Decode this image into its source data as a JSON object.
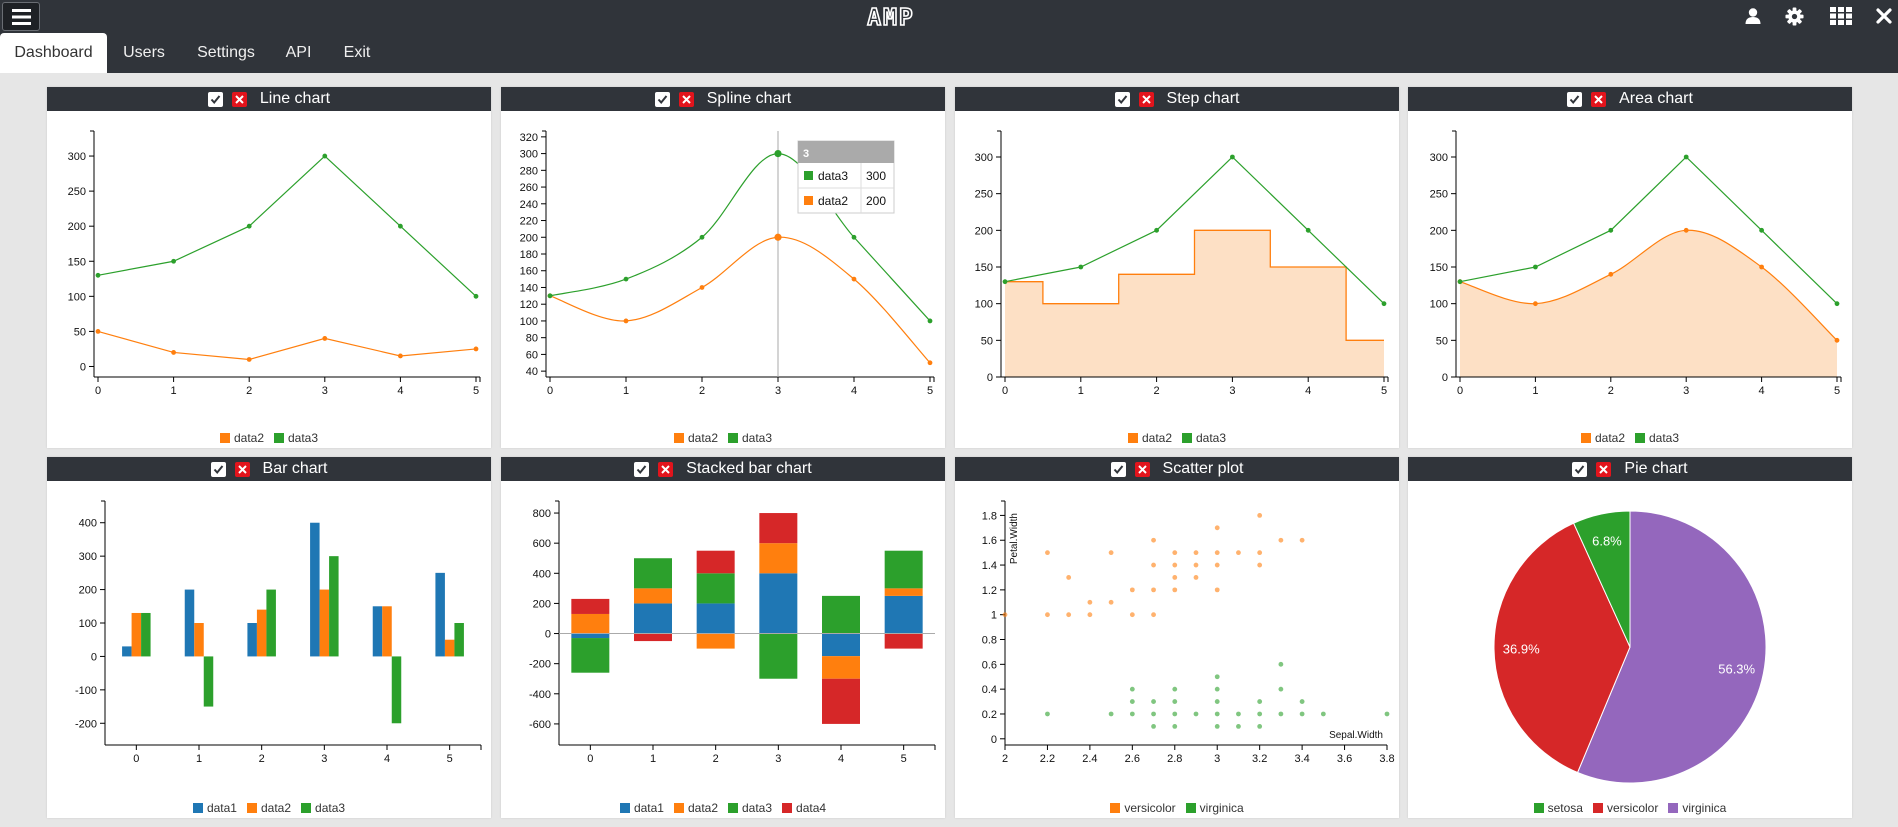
{
  "app": {
    "logo_text": "AMP"
  },
  "nav": {
    "tabs": [
      "Dashboard",
      "Users",
      "Settings",
      "API",
      "Exit"
    ],
    "active": 0
  },
  "icons": [
    "hamburger-menu-icon",
    "user-icon",
    "gear-icon",
    "grid-icon",
    "close-icon"
  ],
  "colors": {
    "data1": "#1f77b4",
    "data2": "#ff7f0e",
    "data3": "#2ca02c",
    "data4": "#d62728",
    "virginica_pie": "#9467bd",
    "header": "#30343a",
    "close_button": "#e2141c"
  },
  "panels": {
    "line": {
      "title": "Line chart"
    },
    "spline": {
      "title": "Spline chart"
    },
    "step": {
      "title": "Step chart"
    },
    "area": {
      "title": "Area chart"
    },
    "bar": {
      "title": "Bar chart"
    },
    "stacked": {
      "title": "Stacked bar chart"
    },
    "scatter": {
      "title": "Scatter plot"
    },
    "pie": {
      "title": "Pie chart"
    }
  },
  "chart_data": [
    {
      "id": "line",
      "type": "line",
      "title": "Line chart",
      "x": [
        0,
        1,
        2,
        3,
        4,
        5
      ],
      "series": [
        {
          "name": "data2",
          "values": [
            50,
            20,
            10,
            40,
            15,
            25
          ]
        },
        {
          "name": "data3",
          "values": [
            130,
            150,
            200,
            300,
            200,
            100
          ]
        }
      ],
      "ylim": [
        -15,
        330
      ],
      "yticks": [
        0,
        50,
        100,
        150,
        200,
        250,
        300
      ],
      "xticks": [
        0,
        1,
        2,
        3,
        4,
        5
      ]
    },
    {
      "id": "spline",
      "type": "line",
      "smooth": true,
      "title": "Spline chart",
      "x": [
        0,
        1,
        2,
        3,
        4,
        5
      ],
      "series": [
        {
          "name": "data2",
          "values": [
            130,
            100,
            140,
            200,
            150,
            50
          ]
        },
        {
          "name": "data3",
          "values": [
            130,
            150,
            200,
            300,
            200,
            100
          ]
        }
      ],
      "ylim": [
        33,
        327
      ],
      "yticks": [
        40,
        60,
        80,
        100,
        120,
        140,
        160,
        180,
        200,
        220,
        240,
        260,
        280,
        300,
        320
      ],
      "xticks": [
        0,
        1,
        2,
        3,
        4,
        5
      ],
      "tooltip": {
        "x": "3",
        "rows": [
          {
            "name": "data3",
            "value": 300
          },
          {
            "name": "data2",
            "value": 200
          }
        ]
      }
    },
    {
      "id": "step",
      "type": "area",
      "step": true,
      "title": "Step chart",
      "x": [
        0,
        1,
        2,
        3,
        4,
        5
      ],
      "series": [
        {
          "name": "data2",
          "values": [
            130,
            100,
            140,
            200,
            150,
            50
          ]
        },
        {
          "name": "data3",
          "values": [
            130,
            150,
            200,
            300,
            200,
            100
          ]
        }
      ],
      "ylim": [
        0,
        330
      ],
      "yticks": [
        0,
        50,
        100,
        150,
        200,
        250,
        300
      ],
      "xticks": [
        0,
        1,
        2,
        3,
        4,
        5
      ]
    },
    {
      "id": "area",
      "type": "area",
      "smooth": true,
      "title": "Area chart",
      "x": [
        0,
        1,
        2,
        3,
        4,
        5
      ],
      "series": [
        {
          "name": "data2",
          "values": [
            130,
            100,
            140,
            200,
            150,
            50
          ]
        },
        {
          "name": "data3",
          "values": [
            130,
            150,
            200,
            300,
            200,
            100
          ]
        }
      ],
      "ylim": [
        0,
        330
      ],
      "yticks": [
        0,
        50,
        100,
        150,
        200,
        250,
        300
      ],
      "xticks": [
        0,
        1,
        2,
        3,
        4,
        5
      ]
    },
    {
      "id": "bar",
      "type": "bar",
      "title": "Bar chart",
      "categories": [
        "0",
        "1",
        "2",
        "3",
        "4",
        "5"
      ],
      "series": [
        {
          "name": "data1",
          "values": [
            30,
            200,
            100,
            400,
            150,
            250
          ]
        },
        {
          "name": "data2",
          "values": [
            130,
            100,
            140,
            200,
            150,
            50
          ]
        },
        {
          "name": "data3",
          "values": [
            130,
            -150,
            200,
            300,
            -200,
            100
          ]
        }
      ],
      "ylim": [
        -265,
        465
      ],
      "yticks": [
        -200,
        -100,
        0,
        100,
        200,
        300,
        400
      ]
    },
    {
      "id": "stacked",
      "type": "bar",
      "stacked": true,
      "title": "Stacked bar chart",
      "categories": [
        "0",
        "1",
        "2",
        "3",
        "4",
        "5"
      ],
      "series": [
        {
          "name": "data1",
          "values": [
            -30,
            200,
            200,
            400,
            -150,
            250
          ]
        },
        {
          "name": "data2",
          "values": [
            130,
            100,
            -100,
            200,
            -150,
            50
          ]
        },
        {
          "name": "data3",
          "values": [
            -230,
            200,
            200,
            -300,
            250,
            250
          ]
        },
        {
          "name": "data4",
          "values": [
            100,
            -50,
            150,
            200,
            -300,
            -100
          ]
        }
      ],
      "ylim": [
        -740,
        880
      ],
      "yticks": [
        -600,
        -400,
        -200,
        0,
        200,
        400,
        600,
        800
      ]
    },
    {
      "id": "scatter",
      "type": "scatter",
      "title": "Scatter plot",
      "xlabel": "Sepal.Width",
      "ylabel": "Petal.Width",
      "xlim": [
        2,
        3.8
      ],
      "ylim": [
        -0.05,
        1.9
      ],
      "xticks": [
        2,
        2.2,
        2.4,
        2.6,
        2.8,
        3,
        3.2,
        3.4,
        3.6,
        3.8
      ],
      "yticks": [
        0,
        0.2,
        0.4,
        0.6,
        0.8,
        1,
        1.2,
        1.4,
        1.6,
        1.8
      ],
      "series": [
        {
          "name": "versicolor",
          "points": [
            [
              2,
              1
            ],
            [
              2.2,
              1
            ],
            [
              2.2,
              1.5
            ],
            [
              2.3,
              1
            ],
            [
              2.3,
              1.3
            ],
            [
              2.4,
              1
            ],
            [
              2.4,
              1.1
            ],
            [
              2.5,
              1.1
            ],
            [
              2.5,
              1.5
            ],
            [
              2.6,
              1
            ],
            [
              2.6,
              1.2
            ],
            [
              2.7,
              1
            ],
            [
              2.7,
              1.2
            ],
            [
              2.7,
              1.4
            ],
            [
              2.7,
              1.6
            ],
            [
              2.8,
              1.2
            ],
            [
              2.8,
              1.3
            ],
            [
              2.8,
              1.4
            ],
            [
              2.8,
              1.5
            ],
            [
              2.9,
              1.3
            ],
            [
              2.9,
              1.4
            ],
            [
              2.9,
              1.5
            ],
            [
              3,
              1.2
            ],
            [
              3,
              1.4
            ],
            [
              3,
              1.5
            ],
            [
              3,
              1.7
            ],
            [
              3.1,
              1.5
            ],
            [
              3.2,
              1.4
            ],
            [
              3.2,
              1.5
            ],
            [
              3.2,
              1.8
            ],
            [
              3.3,
              1.6
            ],
            [
              3.4,
              1.6
            ]
          ]
        },
        {
          "name": "virginica",
          "points": [
            [
              2.2,
              0.2
            ],
            [
              2.5,
              0.2
            ],
            [
              2.6,
              0.2
            ],
            [
              2.6,
              0.3
            ],
            [
              2.6,
              0.4
            ],
            [
              2.7,
              0.1
            ],
            [
              2.7,
              0.2
            ],
            [
              2.7,
              0.3
            ],
            [
              2.8,
              0.1
            ],
            [
              2.8,
              0.2
            ],
            [
              2.8,
              0.3
            ],
            [
              2.8,
              0.4
            ],
            [
              2.9,
              0.2
            ],
            [
              3,
              0.1
            ],
            [
              3,
              0.2
            ],
            [
              3,
              0.3
            ],
            [
              3,
              0.4
            ],
            [
              3,
              0.5
            ],
            [
              3.1,
              0.1
            ],
            [
              3.1,
              0.2
            ],
            [
              3.2,
              0.1
            ],
            [
              3.2,
              0.2
            ],
            [
              3.2,
              0.3
            ],
            [
              3.3,
              0.2
            ],
            [
              3.3,
              0.4
            ],
            [
              3.3,
              0.6
            ],
            [
              3.4,
              0.2
            ],
            [
              3.4,
              0.3
            ],
            [
              3.5,
              0.2
            ],
            [
              3.8,
              0.2
            ]
          ]
        }
      ]
    },
    {
      "id": "pie",
      "type": "pie",
      "title": "Pie chart",
      "slices": [
        {
          "name": "virginica",
          "value": 56.3,
          "label": "56.3%"
        },
        {
          "name": "versicolor",
          "value": 36.9,
          "label": "36.9%"
        },
        {
          "name": "setosa",
          "value": 6.8,
          "label": "6.8%"
        }
      ],
      "legend": [
        "setosa",
        "versicolor",
        "virginica"
      ]
    }
  ]
}
